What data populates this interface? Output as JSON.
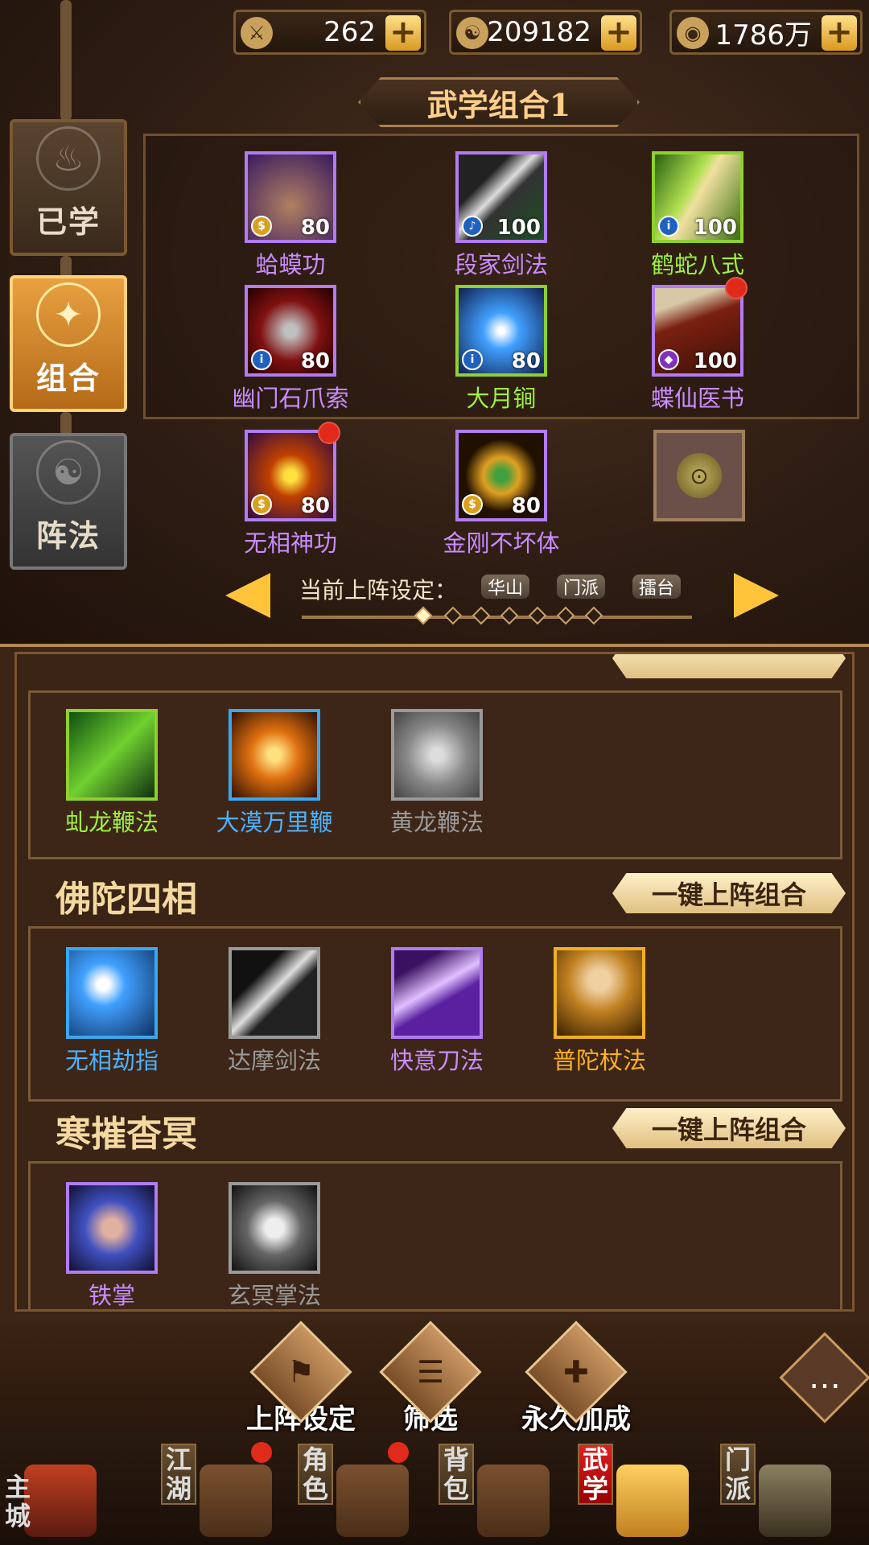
{
  "currency": [
    {
      "icon": "sword-token-icon",
      "value": "262"
    },
    {
      "icon": "taiji-coin-icon",
      "value": "209182"
    },
    {
      "icon": "copper-coin-icon",
      "value": "1786万"
    }
  ],
  "side_tabs": [
    {
      "label": "已学",
      "icon": "book-flame-icon"
    },
    {
      "label": "组合",
      "icon": "scroll-glow-icon"
    },
    {
      "label": "阵法",
      "icon": "yinyang-icon"
    }
  ],
  "combo_title": "武学组合1",
  "equipped": [
    {
      "name": "蛤蟆功",
      "level": "80",
      "color": "purple",
      "icon": "toad-icon",
      "mark": "coin"
    },
    {
      "name": "段家剑法",
      "level": "100",
      "color": "purple",
      "icon": "sword-slash-icon",
      "mark": "bell"
    },
    {
      "name": "鹤蛇八式",
      "level": "100",
      "color": "green",
      "icon": "green-blade-icon",
      "mark": "info"
    },
    {
      "name": "幽门石爪索",
      "level": "80",
      "color": "purple",
      "icon": "claw-chain-icon",
      "mark": "info"
    },
    {
      "name": "大月锏",
      "level": "80",
      "color": "green",
      "icon": "crossed-mace-icon",
      "mark": "info"
    },
    {
      "name": "蝶仙医书",
      "level": "100",
      "color": "purple",
      "icon": "medical-book-icon",
      "mark": "gem"
    },
    {
      "name": "无相神功",
      "level": "80",
      "color": "purple",
      "icon": "shadow-figure-icon",
      "mark": "coin"
    },
    {
      "name": "金刚不坏体",
      "level": "80",
      "color": "purple",
      "icon": "meditation-icon",
      "mark": "coin"
    }
  ],
  "lock_slot": "lock-icon",
  "deploy": {
    "label": "当前上阵设定：",
    "chips": [
      "华山",
      "门派",
      "擂台"
    ]
  },
  "groups": [
    {
      "title": "",
      "skills": [
        {
          "name": "虬龙鞭法",
          "color": "green",
          "icon": "chain-whip-icon"
        },
        {
          "name": "大漠万里鞭",
          "color": "blue",
          "icon": "rope-whip-icon"
        },
        {
          "name": "黄龙鞭法",
          "color": "gray",
          "icon": "gray-whip-icon"
        }
      ]
    },
    {
      "title": "佛陀四相",
      "button": "一键上阵组合",
      "skills": [
        {
          "name": "无相劫指",
          "color": "blue",
          "icon": "finger-strike-icon"
        },
        {
          "name": "达摩剑法",
          "color": "gray",
          "icon": "gray-sword-icon"
        },
        {
          "name": "快意刀法",
          "color": "purple",
          "icon": "saber-icon"
        },
        {
          "name": "普陀杖法",
          "color": "gold",
          "icon": "monk-staff-icon"
        }
      ]
    },
    {
      "title": "寒摧杳冥",
      "button": "一键上阵组合",
      "skills": [
        {
          "name": "铁掌",
          "color": "purple",
          "icon": "iron-palm-icon"
        },
        {
          "name": "玄冥掌法",
          "color": "gray",
          "icon": "gray-palm-icon"
        }
      ]
    }
  ],
  "actions": [
    {
      "label": "上阵设定",
      "icon": "deploy-icon"
    },
    {
      "label": "筛选",
      "icon": "filter-icon"
    },
    {
      "label": "永久加成",
      "icon": "bonus-icon"
    }
  ],
  "bottom_nav": [
    {
      "label": "主城",
      "icon": "city-gate-icon"
    },
    {
      "label": "江湖",
      "icon": "banner-icon",
      "badge": true
    },
    {
      "label": "角色",
      "icon": "scroll-hero-icon",
      "badge": true
    },
    {
      "label": "背包",
      "icon": "bag-icon"
    },
    {
      "label": "武学",
      "icon": "martial-scroll-icon",
      "active": true
    },
    {
      "label": "门派",
      "icon": "cauldron-icon"
    }
  ]
}
